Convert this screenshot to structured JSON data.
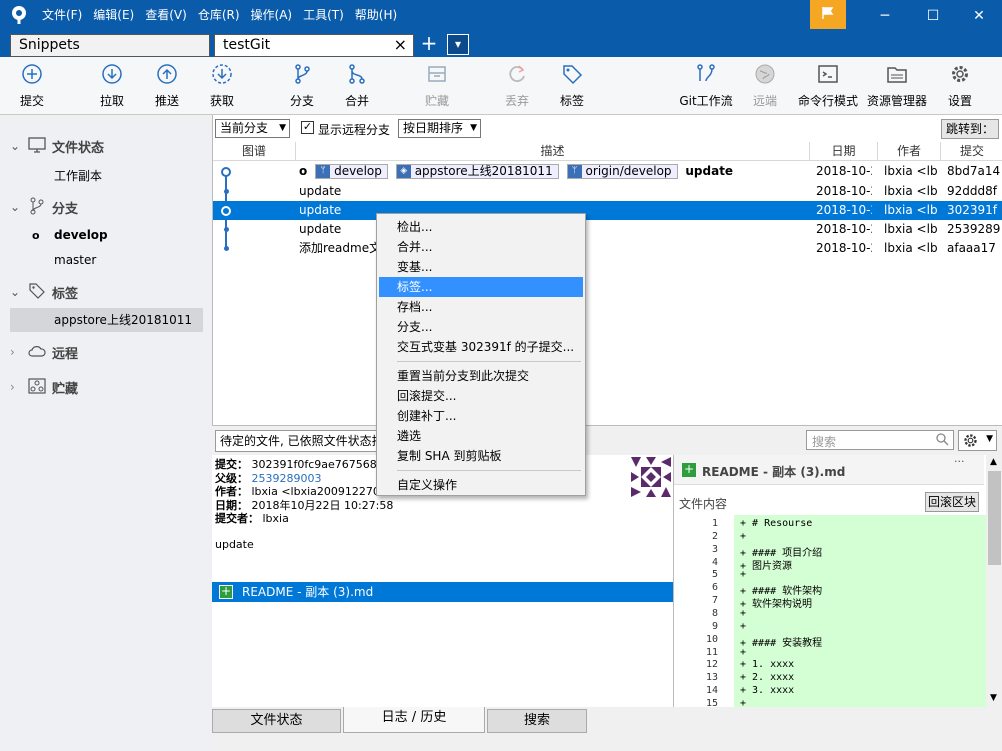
{
  "menu": [
    "文件(F)",
    "编辑(E)",
    "查看(V)",
    "仓库(R)",
    "操作(A)",
    "工具(T)",
    "帮助(H)"
  ],
  "tabs": {
    "snippets": "Snippets",
    "active": "testGit",
    "close": "×",
    "add": "+",
    "dropdown": "▾"
  },
  "toolbar": [
    "提交",
    "拉取",
    "推送",
    "获取",
    "分支",
    "合并",
    "贮藏",
    "丢弃",
    "标签",
    "Git工作流",
    "远端",
    "命令行模式",
    "资源管理器",
    "设置"
  ],
  "sidebar": {
    "file_status": "文件状态",
    "working_copy": "工作副本",
    "branches": "分支",
    "develop": "develop",
    "master": "master",
    "tags": "标签",
    "tag_item": "appstore上线20181011",
    "remote": "远程",
    "stash": "贮藏"
  },
  "filter": {
    "branch_select": "当前分支",
    "show_remote": "显示远程分支",
    "sort_select": "按日期排序",
    "jump_to": "跳转到："
  },
  "columns": {
    "graph": "图谱",
    "desc": "描述",
    "date": "日期",
    "author": "作者",
    "commit": "提交"
  },
  "commits": [
    {
      "badges": [
        "develop",
        "appstore上线20181011",
        "origin/develop"
      ],
      "desc": "update",
      "date": "2018-10-2",
      "author": "lbxia <lb",
      "hash": "8bd7a14"
    },
    {
      "desc": "update",
      "date": "2018-10-2",
      "author": "lbxia <lb",
      "hash": "92ddd8f"
    },
    {
      "desc": "update",
      "date": "2018-10-2",
      "author": "lbxia <lb",
      "hash": "302391f"
    },
    {
      "desc": "update",
      "date": "2018-10-2",
      "author": "lbxia <lb",
      "hash": "2539289"
    },
    {
      "desc": "添加readme文",
      "date": "2018-10-2",
      "author": "lbxia <lb",
      "hash": "afaaa17"
    }
  ],
  "context_menu": {
    "group1": [
      "检出...",
      "合并...",
      "变基...",
      "标签...",
      "存档...",
      "分支...",
      "交互式变基 302391f 的子提交..."
    ],
    "group2": [
      "重置当前分支到此次提交",
      "回滚提交...",
      "创建补丁...",
      "遴选",
      "复制 SHA 到剪贴板"
    ],
    "group3": [
      "自定义操作"
    ]
  },
  "staged_label": "待定的文件, 已依照文件状态排",
  "search_placeholder": "搜索",
  "details": {
    "commit_label": "提交：",
    "commit_value": "302391f0fc9ae767568",
    "parent_label": "父级：",
    "parent_value": "2539289003",
    "author_label": "作者：",
    "author_value": "lbxia <lbxia200912270",
    "date_label": "日期：",
    "date_value": "2018年10月22日 10:27:58",
    "committer_label": "提交者：",
    "committer_value": "lbxia",
    "message": "update"
  },
  "file_item": "README - 副本 (3).md",
  "diff": {
    "title": "README - 副本 (3).md",
    "more": "···",
    "content_label": "文件内容",
    "revert_button": "回滚区块",
    "lines": [
      {
        "n": "1",
        "t": "+ # Resourse"
      },
      {
        "n": "2",
        "t": "+"
      },
      {
        "n": "3",
        "t": "+ #### 项目介绍"
      },
      {
        "n": "4",
        "t": "+ 图片资源"
      },
      {
        "n": "5",
        "t": "+"
      },
      {
        "n": "6",
        "t": "+ #### 软件架构"
      },
      {
        "n": "7",
        "t": "+ 软件架构说明"
      },
      {
        "n": "8",
        "t": "+"
      },
      {
        "n": "9",
        "t": "+"
      },
      {
        "n": "10",
        "t": "+ #### 安装教程"
      },
      {
        "n": "11",
        "t": "+"
      },
      {
        "n": "12",
        "t": "+ 1. xxxx"
      },
      {
        "n": "13",
        "t": "+ 2. xxxx"
      },
      {
        "n": "14",
        "t": "+ 3. xxxx"
      },
      {
        "n": "15",
        "t": "+"
      }
    ]
  },
  "bottom_tabs": [
    "文件状态",
    "日志 / 历史",
    "搜索"
  ],
  "colors": {
    "titlebar": "#0a5cab",
    "selection": "#0078d7",
    "menu_highlight": "#3391ff",
    "diff_add": "#d4ffd4",
    "flag": "#f5a623"
  }
}
